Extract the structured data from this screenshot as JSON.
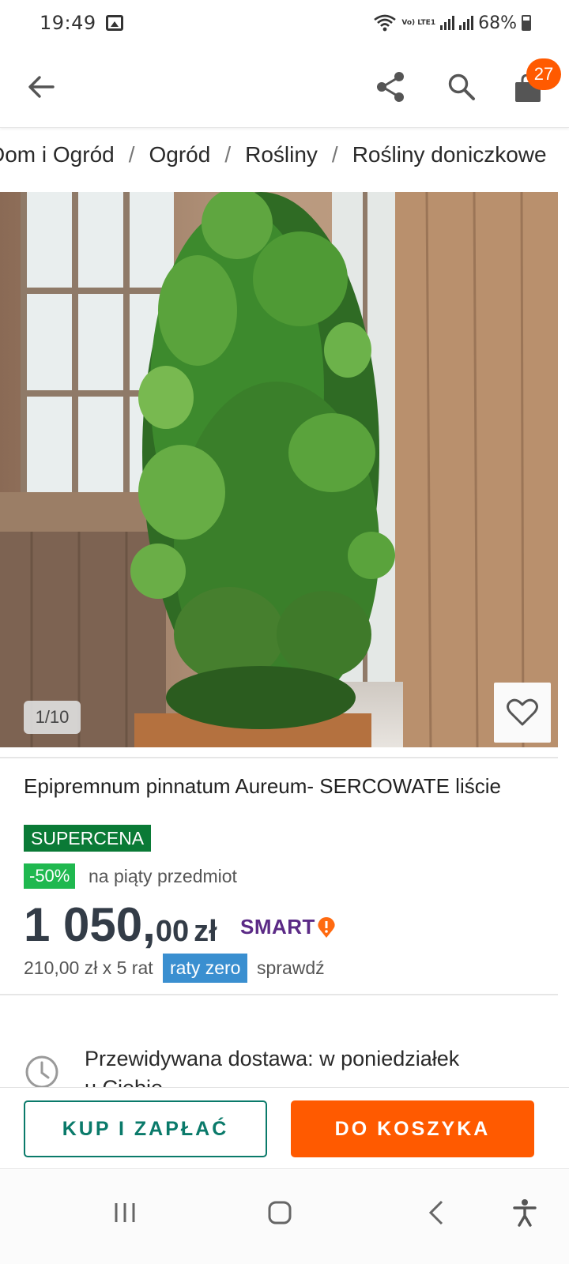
{
  "status_bar": {
    "time": "19:49",
    "battery": "68%",
    "network_label": "Vo) LTE1"
  },
  "header": {
    "cart_count": "27"
  },
  "breadcrumb": [
    "Dom i Ogród",
    "Ogród",
    "Rośliny",
    "Rośliny doniczkowe"
  ],
  "gallery": {
    "counter": "1/10"
  },
  "product": {
    "title": "Epipremnum pinnatum Aureum- SERCOWATE liście",
    "badge": "SUPERCENA",
    "discount_badge": "-50%",
    "discount_text": "na piąty przedmiot",
    "price_integer": "1 050,",
    "price_decimal": "00",
    "price_currency": "zł",
    "smart_label": "SMART",
    "installment_text": "210,00 zł x 5 rat",
    "installment_badge": "raty zero",
    "installment_link": "sprawdź"
  },
  "delivery": {
    "line1": "Przewidywana dostawa: w poniedziałek",
    "line2": "u Ciebie"
  },
  "actions": {
    "buy_now": "KUP I ZAPŁAĆ",
    "add_to_cart": "DO KOSZYKA"
  },
  "colors": {
    "accent_orange": "#ff5a00",
    "teal": "#0a7a6a",
    "supercena_green": "#0a7a36",
    "discount_green": "#1fb84f",
    "raty_blue": "#3a8fd0",
    "smart_purple": "#5b2a86"
  }
}
